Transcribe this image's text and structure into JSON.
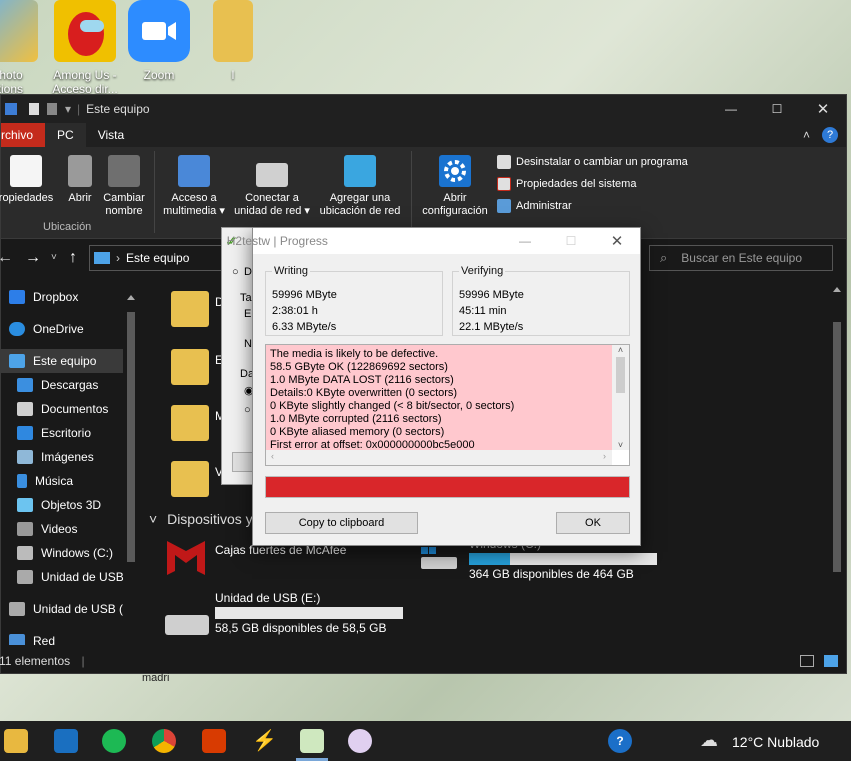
{
  "desktop": {
    "icons": [
      {
        "label": "Photo\nations"
      },
      {
        "label": "Among Us -\nAcceso dir..."
      },
      {
        "label": "Zoom"
      },
      {
        "label": "l"
      }
    ]
  },
  "explorer": {
    "title": "Este equipo",
    "menu_tabs": [
      "rchivo",
      "PC",
      "Vista"
    ],
    "ribbon": {
      "buttons": [
        {
          "label": "ropiedades"
        },
        {
          "label": "Abrir"
        },
        {
          "label": "Cambiar\nnombre"
        },
        {
          "label": "Acceso a\nmultimedia ▾"
        },
        {
          "label": "Conectar a\nunidad de red ▾"
        },
        {
          "label": "Agregar una\nubicación de red"
        },
        {
          "label": "Abrir\nconfiguración"
        }
      ],
      "small_items": [
        "Desinstalar o cambiar un programa",
        "Propiedades del sistema",
        "Administrar"
      ],
      "group_label": "Ubicación"
    },
    "address": "Este equipo",
    "search_placeholder": "Buscar en Este equipo",
    "sidebar": [
      "Dropbox",
      "OneDrive",
      "Este equipo",
      "Descargas",
      "Documentos",
      "Escritorio",
      "Imágenes",
      "Música",
      "Objetos 3D",
      "Videos",
      "Windows (C:)",
      "Unidad de USB (",
      "Unidad de USB (E:",
      "Red"
    ],
    "section_title": "Dispositivos y",
    "folder_letters": [
      "D",
      "E",
      "M",
      "V"
    ],
    "drives": [
      {
        "name": "Cajas fuertes de McAfee",
        "info": ""
      },
      {
        "name": "Windows (C:)",
        "info": "364 GB disponibles de 464 GB",
        "fill": 0.22
      },
      {
        "name": "Unidad de USB (E:)",
        "info": "58,5 GB disponibles de 58,5 GB",
        "fill": 0.0
      }
    ],
    "status": "11 elementos"
  },
  "dialog": {
    "title": "H2testw | Progress",
    "writing": {
      "header": "Writing",
      "lines": [
        "59996 MByte",
        "2:38:01 h",
        "6.33 MByte/s"
      ]
    },
    "verifying": {
      "header": "Verifying",
      "lines": [
        "59996 MByte",
        "45:11 min",
        "22.1 MByte/s"
      ]
    },
    "log": [
      "The media is likely to be defective.",
      "58.5 GByte OK (122869692 sectors)",
      "1.0 MByte DATA LOST (2116 sectors)",
      "Details:0 KByte overwritten (0 sectors)",
      "0 KByte slightly changed (< 8 bit/sector, 0 sectors)",
      "1.0 MByte corrupted (2116 sectors)",
      "0 KByte aliased memory (0 sectors)",
      "First error at offset: 0x000000000bc5e000"
    ],
    "progress": 1.0,
    "progress_color": "#d9262a",
    "copy_label": "Copy to clipboard",
    "ok_label": "OK"
  },
  "behind_dialog": {
    "label_ta": "Ta",
    "label_n": "N",
    "label_da": "Da",
    "label_e": "E",
    "label_d": "D"
  },
  "taskbar": {
    "weather": "12°C  Nublado",
    "below_label": "madri"
  }
}
